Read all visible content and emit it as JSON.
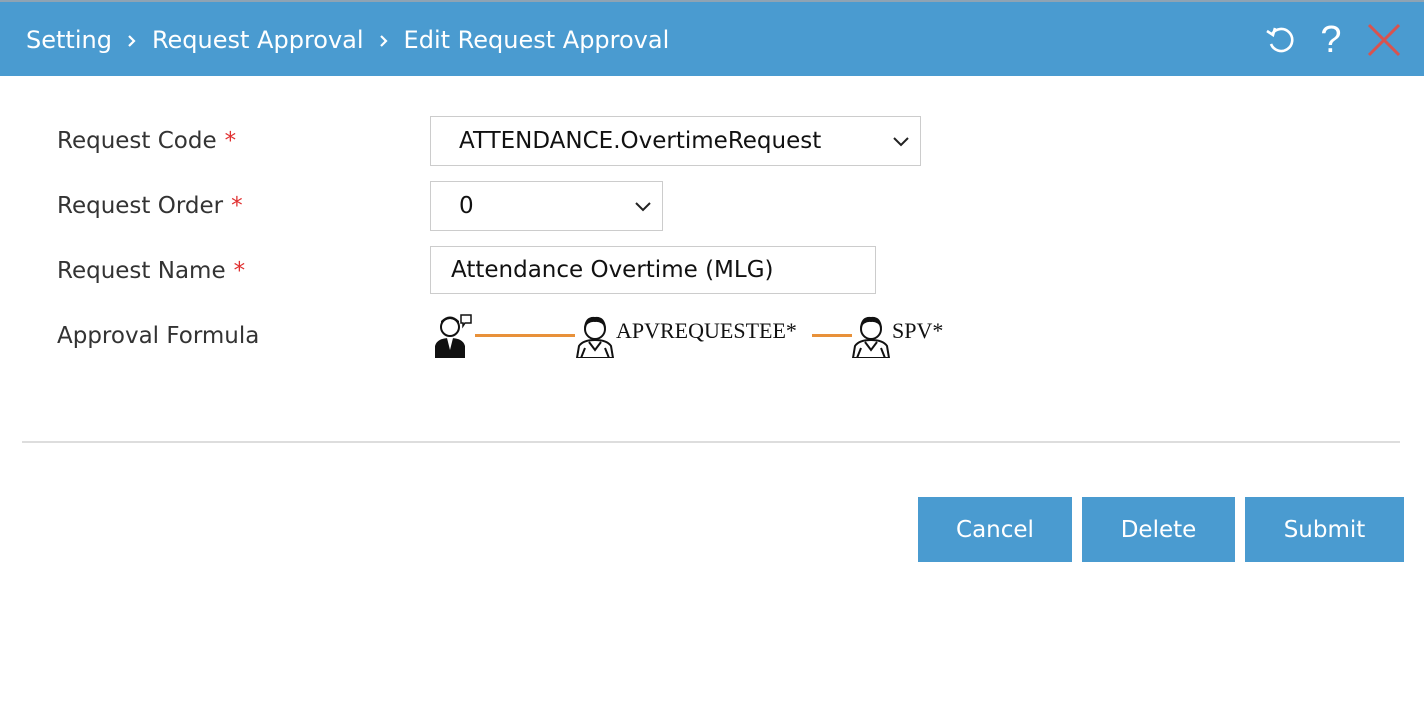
{
  "header": {
    "breadcrumb": [
      "Setting",
      "Request Approval",
      "Edit Request Approval"
    ],
    "icons": [
      "refresh-icon",
      "help-icon",
      "close-icon"
    ],
    "help_glyph": "?"
  },
  "form": {
    "request_code": {
      "label": "Request Code",
      "required": "*",
      "value": "ATTENDANCE.OvertimeRequest"
    },
    "request_order": {
      "label": "Request Order",
      "required": "*",
      "value": "0"
    },
    "request_name": {
      "label": "Request Name",
      "required": "*",
      "value": "Attendance Overtime (MLG)"
    },
    "approval_formula": {
      "label": "Approval Formula",
      "nodes": [
        "APVREQUESTEE*",
        "SPV*"
      ]
    }
  },
  "actions": {
    "cancel": "Cancel",
    "delete": "Delete",
    "submit": "Submit"
  },
  "colors": {
    "header_bg": "#4a9bd0",
    "button_bg": "#4a9bd0",
    "required": "#e03030",
    "close_icon": "#d9534f",
    "connector": "#e8913a"
  }
}
